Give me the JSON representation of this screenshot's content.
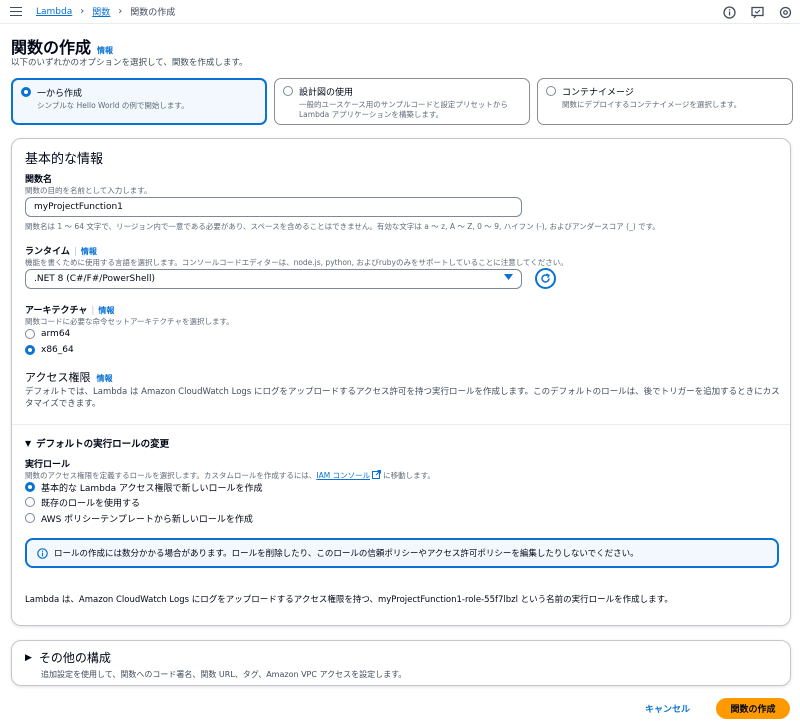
{
  "breadcrumb": {
    "items": [
      "Lambda",
      "関数"
    ],
    "current": "関数の作成"
  },
  "page": {
    "title": "関数の作成",
    "info": "情報",
    "subtitle": "以下のいずれかのオプションを選択して、関数を作成します。"
  },
  "options": [
    {
      "title": "一から作成",
      "desc": "シンプルな Hello World の例で開始します。",
      "selected": true
    },
    {
      "title": "設計図の使用",
      "desc": "一般的ユースケース用のサンプルコードと設定プリセットから Lambda アプリケーションを構築します。",
      "selected": false
    },
    {
      "title": "コンテナイメージ",
      "desc": "関数にデプロイするコンテナイメージを選択します。",
      "selected": false
    }
  ],
  "basic": {
    "title": "基本的な情報",
    "name_label": "関数名",
    "name_desc": "関数の目的を名前として入力します。",
    "name_value": "myProjectFunction1",
    "name_hint": "関数名は 1 〜 64 文字で、リージョン内で一意である必要があり、スペースを含めることはできません。有効な文字は a 〜 z, A 〜 Z, 0 〜 9, ハイフン (-), およびアンダースコア (_) です。",
    "runtime_label": "ランタイム",
    "runtime_info": "情報",
    "runtime_desc": "機能を書くために使用する言語を選択します。コンソールコードエディターは、node.js, python, およびrubyのみをサポートしていることに注意してください。",
    "runtime_value": ".NET 8 (C#/F#/PowerShell)",
    "arch_label": "アーキテクチャ",
    "arch_info": "情報",
    "arch_desc": "関数コードに必要な命令セットアーキテクチャを選択します。",
    "arch_options": [
      {
        "label": "arm64",
        "selected": false
      },
      {
        "label": "x86_64",
        "selected": true
      }
    ]
  },
  "permissions": {
    "title": "アクセス権限",
    "info": "情報",
    "desc": "デフォルトでは、Lambda は Amazon CloudWatch Logs にログをアップロードするアクセス許可を持つ実行ロールを作成します。このデフォルトのロールは、後でトリガーを追加するときにカスタマイズできます。",
    "expander": "デフォルトの実行ロールの変更",
    "role_label": "実行ロール",
    "role_desc_pre": "関数のアクセス権限を定義するロールを選択します。カスタムロールを作成するには、",
    "role_link": "IAM コンソール",
    "role_desc_post": "に移動します。",
    "role_options": [
      {
        "label": "基本的な Lambda アクセス権限で新しいロールを作成",
        "selected": true
      },
      {
        "label": "既存のロールを使用する",
        "selected": false
      },
      {
        "label": "AWS ポリシーテンプレートから新しいロールを作成",
        "selected": false
      }
    ],
    "alert": "ロールの作成には数分かかる場合があります。ロールを削除したり、このロールの信頼ポリシーやアクセス許可ポリシーを編集したりしないでください。",
    "footer": "Lambda は、Amazon CloudWatch Logs にログをアップロードするアクセス権限を持つ、myProjectFunction1-role-55f7lbzl という名前の実行ロールを作成します。"
  },
  "other": {
    "title": "その他の構成",
    "desc": "追加設定を使用して、関数へのコード署名、関数 URL、タグ、Amazon VPC アクセスを設定します。"
  },
  "actions": {
    "cancel": "キャンセル",
    "create": "関数の作成"
  },
  "colors": {
    "accent": "#0972d3",
    "primary_button": "#ff9900"
  }
}
